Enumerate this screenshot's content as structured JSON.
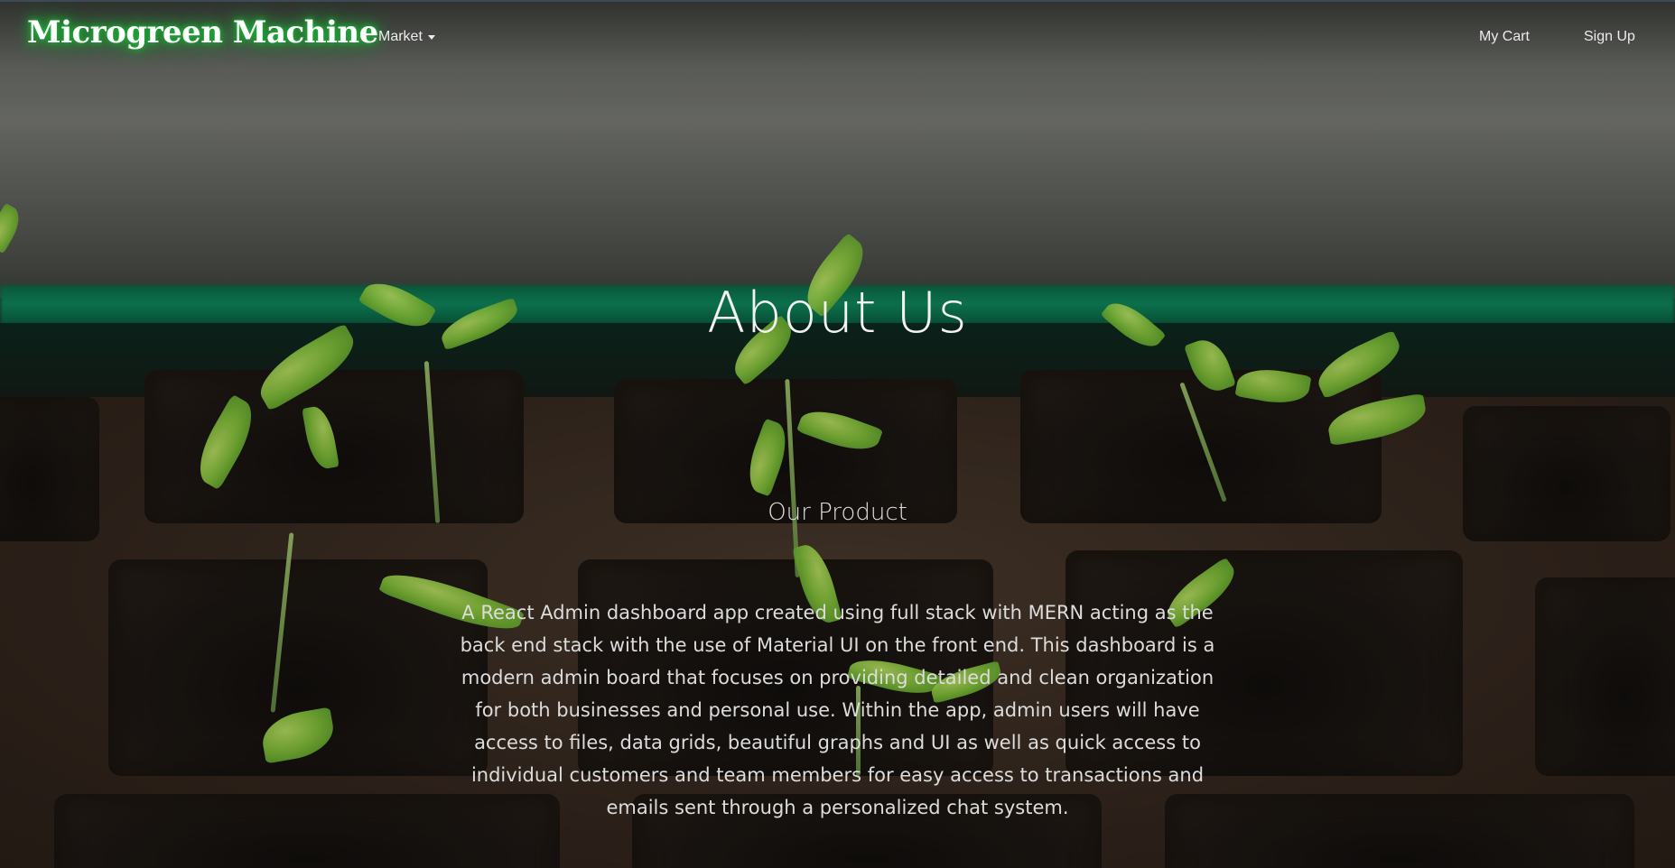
{
  "navbar": {
    "brand": "Microgreen Machine",
    "market_label": "Market",
    "cart_label": "My Cart",
    "signup_label": "Sign Up"
  },
  "hero": {
    "title": "About Us",
    "subtitle": "Our Product",
    "body": "A React Admin dashboard app created using full stack with MERN acting as the back end stack with the use of Material UI on the front end. This dashboard is a modern admin board that focuses on providing detailed and clean organization for both businesses and personal use. Within the app, admin users will have access to files, data grids, beautiful graphs and UI as well as quick access to individual customers and team members for easy access to transactions and emails sent through a personalized chat system."
  },
  "colors": {
    "brand_glow": "#1db83a",
    "nav_text": "#ececec",
    "hero_text": "#f2f2f2"
  },
  "icons": {
    "market_dropdown": "caret-down-icon"
  }
}
